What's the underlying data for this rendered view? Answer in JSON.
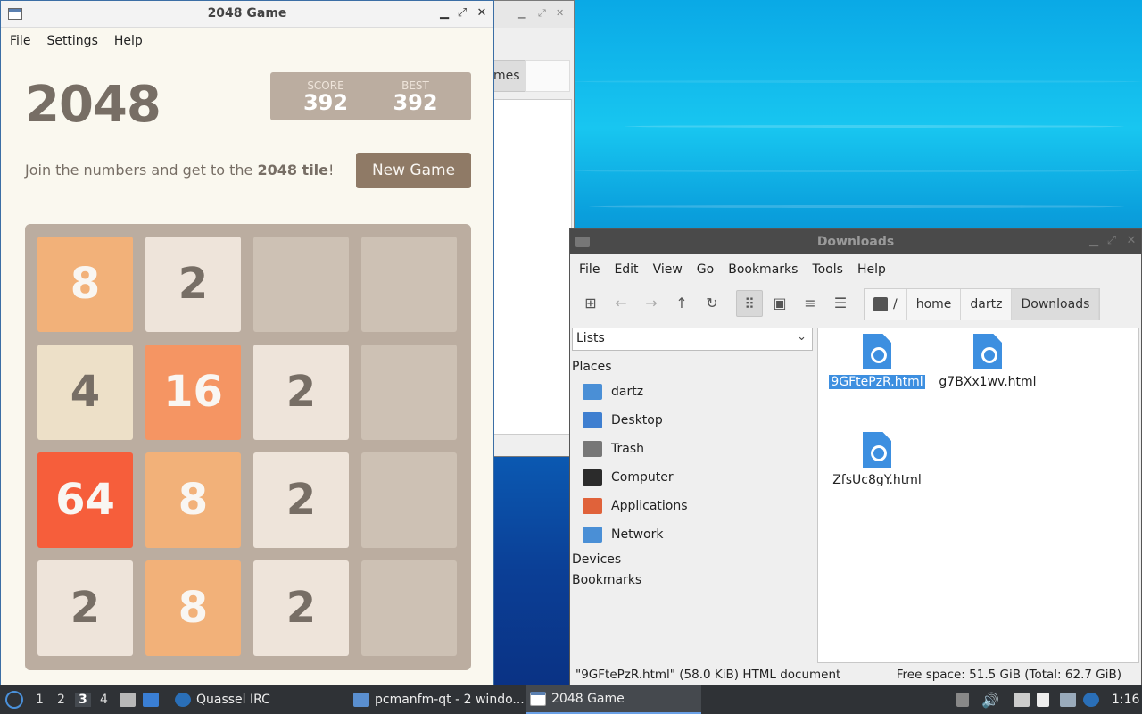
{
  "colors": {
    "tile_empty": "#cdc1b4",
    "board_bg": "#bbada0",
    "accent_selection": "#3d8fe0"
  },
  "game_window": {
    "title": "2048 Game",
    "menu": [
      "File",
      "Settings",
      "Help"
    ],
    "logo": "2048",
    "score_label": "SCORE",
    "score": "392",
    "best_label": "BEST",
    "best": "392",
    "intro_prefix": "Join the numbers and get to the ",
    "intro_bold": "2048 tile",
    "intro_suffix": "!",
    "new_game": "New Game",
    "grid": [
      [
        8,
        2,
        0,
        0
      ],
      [
        4,
        16,
        2,
        0
      ],
      [
        64,
        8,
        2,
        0
      ],
      [
        2,
        8,
        2,
        0
      ]
    ]
  },
  "bg_window": {
    "tab_text": "mes"
  },
  "file_manager": {
    "title": "Downloads",
    "menu": [
      "File",
      "Edit",
      "View",
      "Go",
      "Bookmarks",
      "Tools",
      "Help"
    ],
    "breadcrumb": [
      "/",
      "home",
      "dartz",
      "Downloads"
    ],
    "side_mode": "Lists",
    "places_header": "Places",
    "places": [
      {
        "label": "dartz",
        "icon": "home-folder-icon",
        "color": "#4a8fd6"
      },
      {
        "label": "Desktop",
        "icon": "desktop-icon",
        "color": "#3f7fd0"
      },
      {
        "label": "Trash",
        "icon": "trash-icon",
        "color": "#777777"
      },
      {
        "label": "Computer",
        "icon": "computer-icon",
        "color": "#2b2b2b"
      },
      {
        "label": "Applications",
        "icon": "applications-icon",
        "color": "#e0623a"
      },
      {
        "label": "Network",
        "icon": "network-folder-icon",
        "color": "#4a8fd6"
      }
    ],
    "devices_header": "Devices",
    "bookmarks_header": "Bookmarks",
    "files": [
      {
        "name": "9GFtePzR.html",
        "selected": true
      },
      {
        "name": "g7BXx1wv.html",
        "selected": false
      },
      {
        "name": "ZfsUc8gY.html",
        "selected": false
      }
    ],
    "status_left": "\"9GFtePzR.html\" (58.0 KiB) HTML document",
    "status_right": "Free space: 51.5 GiB (Total: 62.7 GiB)"
  },
  "taskbar": {
    "workspaces": [
      "1",
      "2",
      "3",
      "4"
    ],
    "current_workspace": "3",
    "tasks": [
      "Quassel IRC",
      "pcmanfm-qt - 2 windo...",
      "2048 Game"
    ],
    "clock": "1:16"
  }
}
